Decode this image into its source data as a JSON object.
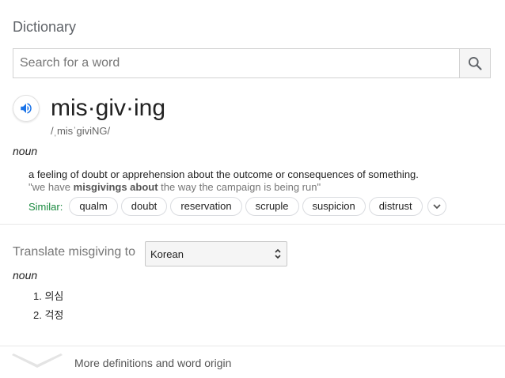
{
  "header": {
    "title": "Dictionary"
  },
  "search": {
    "placeholder": "Search for a word",
    "value": ""
  },
  "entry": {
    "word": "mis·giv·ing",
    "pronunciation": "/ˌmisˈɡiviNG/",
    "part_of_speech": "noun",
    "definition": "a feeling of doubt or apprehension about the outcome or consequences of something.",
    "example": {
      "prefix": "\"we have ",
      "bold": "misgivings about",
      "suffix": " the way the campaign is being run\""
    },
    "similar_label": "Similar:",
    "similar": [
      "qualm",
      "doubt",
      "reservation",
      "scruple",
      "suspicion",
      "distrust"
    ]
  },
  "translate": {
    "label": "Translate misgiving to",
    "selected_language": "Korean",
    "part_of_speech": "noun",
    "items": [
      "1. 의심",
      "2. 걱정"
    ]
  },
  "footer": {
    "more_label": "More definitions and word origin"
  },
  "colors": {
    "accent": "#1a73e8",
    "similar_label": "#1a8a3f",
    "muted": "#777777"
  }
}
